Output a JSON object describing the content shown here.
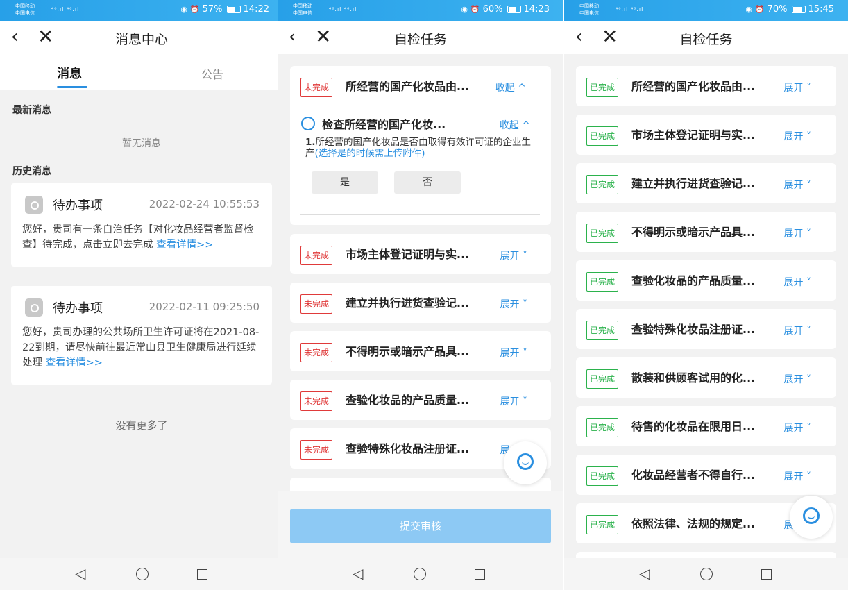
{
  "status_bars": [
    {
      "carrier1": "中国移动",
      "carrier2": "中国电信",
      "signal": "⁴⁶.ıl ⁴⁶.ıl",
      "battery_text": "57%",
      "battery_level": 0.57,
      "time": "14:22"
    },
    {
      "carrier1": "中国移动",
      "carrier2": "中国电信",
      "signal": "⁴⁶.ıl ⁴⁶.ıl",
      "battery_text": "60%",
      "battery_level": 0.6,
      "time": "14:23"
    },
    {
      "carrier1": "中国移动",
      "carrier2": "中国电信",
      "signal": "⁴⁶.ıl ⁴⁶.ıl",
      "battery_text": "70%",
      "battery_level": 0.7,
      "time": "15:45"
    }
  ],
  "nav_icons": {
    "back": "‹",
    "close": "✕"
  },
  "panel1": {
    "title": "消息中心",
    "tabs": [
      "消息",
      "公告"
    ],
    "latest_label": "最新消息",
    "latest_empty": "暂无消息",
    "history_label": "历史消息",
    "messages": [
      {
        "title": "待办事项",
        "time": "2022-02-24 10:55:53",
        "body": "您好，贵司有一条自治任务【对化妆品经营者监督检查】待完成，点击立即去完成 ",
        "link": "查看详情>>"
      },
      {
        "title": "待办事项",
        "time": "2022-02-11 09:25:50",
        "body": "您好，贵司办理的公共场所卫生许可证将在2021-08-22到期，请尽快前往最近常山县卫生健康局进行延续处理 ",
        "link": "查看详情>>"
      }
    ],
    "no_more": "没有更多了"
  },
  "panel2": {
    "title": "自检任务",
    "expanded_task": {
      "status": "未完成",
      "title": "所经营的国产化妆品由...",
      "toggle": "收起 ^",
      "sub_title": "检查所经营的国产化妆...",
      "sub_toggle": "收起 ^",
      "q_num": "1.",
      "question": "所经营的国产化妆品是否由取得有效许可证的企业生产",
      "hint": "(选择是的时候需上传附件)",
      "choices": [
        "是",
        "否"
      ]
    },
    "tasks": [
      {
        "status": "未完成",
        "title": "市场主体登记证明与实...",
        "toggle": "展开 ˅"
      },
      {
        "status": "未完成",
        "title": "建立并执行进货查验记...",
        "toggle": "展开 ˅"
      },
      {
        "status": "未完成",
        "title": "不得明示或暗示产品具...",
        "toggle": "展开 ˅"
      },
      {
        "status": "未完成",
        "title": "查验化妆品的产品质量...",
        "toggle": "展开 ˅"
      },
      {
        "status": "未完成",
        "title": "查验特殊化妆品注册证...",
        "toggle": "展开 ˅"
      }
    ],
    "submit": "提交审核"
  },
  "panel3": {
    "title": "自检任务",
    "tasks": [
      {
        "status": "已完成",
        "title": "所经营的国产化妆品由...",
        "toggle": "展开 ˅"
      },
      {
        "status": "已完成",
        "title": "市场主体登记证明与实...",
        "toggle": "展开 ˅"
      },
      {
        "status": "已完成",
        "title": "建立并执行进货查验记...",
        "toggle": "展开 ˅"
      },
      {
        "status": "已完成",
        "title": "不得明示或暗示产品具...",
        "toggle": "展开 ˅"
      },
      {
        "status": "已完成",
        "title": "查验化妆品的产品质量...",
        "toggle": "展开 ˅"
      },
      {
        "status": "已完成",
        "title": "查验特殊化妆品注册证...",
        "toggle": "展开 ˅"
      },
      {
        "status": "已完成",
        "title": "散装和供顾客试用的化...",
        "toggle": "展开 ˅"
      },
      {
        "status": "已完成",
        "title": "待售的化妆品在限用日...",
        "toggle": "展开 ˅"
      },
      {
        "status": "已完成",
        "title": "化妆品经营者不得自行...",
        "toggle": "展开 ˅"
      },
      {
        "status": "已完成",
        "title": "依照法律、法规的规定...",
        "toggle": "展开 ˅"
      }
    ]
  },
  "bottom_nav": {
    "back": "◁",
    "home": "○",
    "recent": "□"
  }
}
